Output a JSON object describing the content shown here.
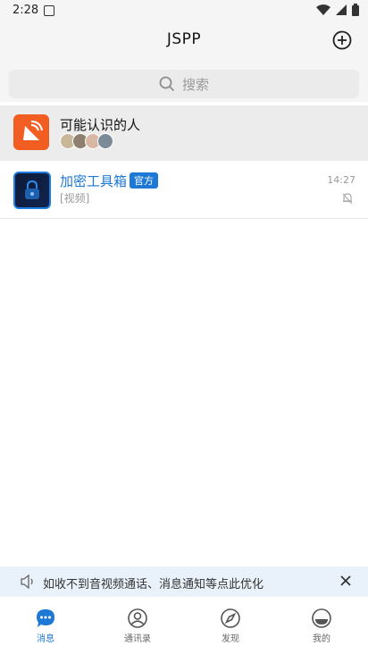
{
  "status_bar": {
    "time": "2:28"
  },
  "app": {
    "title": "JSPP"
  },
  "search": {
    "placeholder": "搜索"
  },
  "people_suggestion": {
    "title": "可能认识的人"
  },
  "chats": [
    {
      "name": "加密工具箱",
      "badge": "官方",
      "preview": "[视频]",
      "time": "14:27"
    }
  ],
  "notice": {
    "text": "如收不到音视频通话、消息通知等点此优化"
  },
  "tabs": [
    {
      "label": "消息",
      "active": true
    },
    {
      "label": "通讯录",
      "active": false
    },
    {
      "label": "发现",
      "active": false
    },
    {
      "label": "我的",
      "active": false
    }
  ],
  "colors": {
    "accent": "#1e78d6",
    "people_icon_bg": "#f25d22",
    "notice_bg": "#e9f1fb"
  }
}
